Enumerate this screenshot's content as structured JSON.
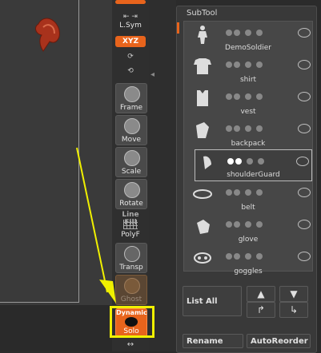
{
  "toolbar": {
    "lsym": "L.Sym",
    "xyz": "XYZ",
    "frame": "Frame",
    "move": "Move",
    "scale": "Scale",
    "rotate": "Rotate",
    "line_fill": "Line Fill",
    "polyf": "PolyF",
    "transp": "Transp",
    "ghost": "Ghost",
    "dynamic": "Dynamic",
    "solo": "Solo"
  },
  "subtool": {
    "title": "SubTool",
    "items": [
      {
        "name": "DemoSoldier",
        "selected": false
      },
      {
        "name": "shirt",
        "selected": false
      },
      {
        "name": "vest",
        "selected": false
      },
      {
        "name": "backpack",
        "selected": false
      },
      {
        "name": "shoulderGuard",
        "selected": true
      },
      {
        "name": "belt",
        "selected": false
      },
      {
        "name": "glove",
        "selected": false
      },
      {
        "name": "goggles",
        "selected": false
      }
    ],
    "list_all": "List All",
    "rename": "Rename",
    "autoreorder": "AutoReorder"
  },
  "colors": {
    "accent_orange": "#e8641c",
    "highlight_yellow": "#f0f000"
  }
}
